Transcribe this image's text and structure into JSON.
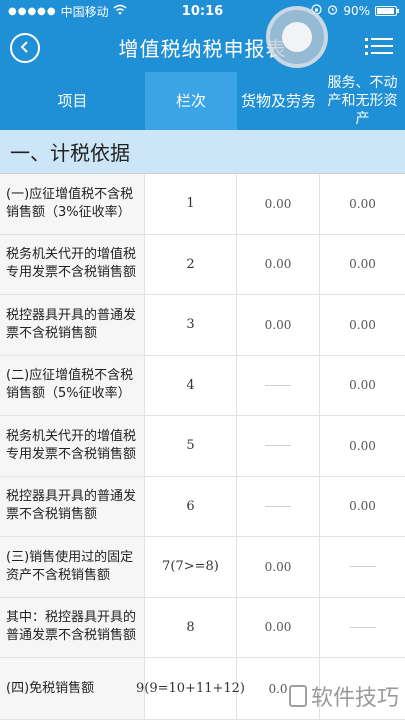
{
  "status_bar": {
    "signal_dots": "●●●●●",
    "carrier": "中国移动",
    "time": "10:16",
    "battery_percent": "90%",
    "icons": [
      "wifi-icon",
      "lock-rotation-icon",
      "alarm-icon",
      "battery-icon"
    ]
  },
  "navbar": {
    "title": "增值税纳税申报表",
    "back_icon": "back-circle-icon",
    "menu_icon": "list-menu-icon"
  },
  "table_header": {
    "col_item": "项目",
    "col_line": "栏次",
    "col_goods": "货物及劳务",
    "col_services": "服务、不动产和无形资产"
  },
  "section": {
    "title": "一、计税依据"
  },
  "rows": [
    {
      "name": "(一)应征增值税不含税销售额（3%征收率）",
      "line": "1",
      "goods": "0.00",
      "services": "0.00"
    },
    {
      "name": "税务机关代开的增值税专用发票不含税销售额",
      "line": "2",
      "goods": "0.00",
      "services": "0.00"
    },
    {
      "name": "税控器具开具的普通发票不含税销售额",
      "line": "3",
      "goods": "0.00",
      "services": "0.00"
    },
    {
      "name": "(二)应征增值税不含税销售额（5%征收率）",
      "line": "4",
      "goods": "",
      "services": "0.00"
    },
    {
      "name": "税务机关代开的增值税专用发票不含税销售额",
      "line": "5",
      "goods": "",
      "services": "0.00"
    },
    {
      "name": "税控器具开具的普通发票不含税销售额",
      "line": "6",
      "goods": "",
      "services": "0.00"
    },
    {
      "name": "(三)销售使用过的固定资产不含税销售额",
      "line": "7(7>=8)",
      "goods": "0.00",
      "services": ""
    },
    {
      "name": "其中：税控器具开具的普通发票不含税销售额",
      "line": "8",
      "goods": "0.00",
      "services": ""
    },
    {
      "name": "(四)免税销售额",
      "line": "9(9=10+11+12)",
      "goods": "0.0",
      "services": ""
    }
  ],
  "watermark": {
    "text": "软件技巧"
  },
  "colors": {
    "primary": "#1f8fd6",
    "header_highlight": "#3aa4e6",
    "section_bg": "#cce6f7",
    "name_cell_bg": "#f6f6f6"
  }
}
